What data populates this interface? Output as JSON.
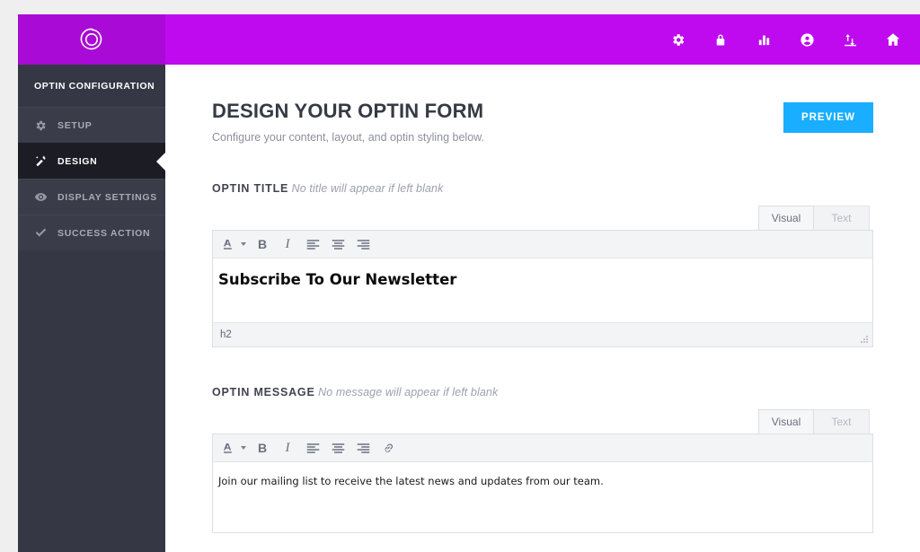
{
  "topbar": {
    "logo_icon": "rosette-logo-icon",
    "brand_color": "#bf0aef",
    "logo_block_color": "#a90ad5",
    "nav_icons": [
      {
        "name": "gear-icon"
      },
      {
        "name": "lock-icon"
      },
      {
        "name": "bar-chart-icon"
      },
      {
        "name": "user-circle-icon"
      },
      {
        "name": "import-export-icon"
      },
      {
        "name": "home-icon"
      }
    ]
  },
  "sidebar": {
    "heading": "OPTIN CONFIGURATION",
    "items": [
      {
        "label": "SETUP",
        "icon": "gear-icon",
        "active": false
      },
      {
        "label": "DESIGN",
        "icon": "magic-wand-icon",
        "active": true
      },
      {
        "label": "DISPLAY SETTINGS",
        "icon": "eye-icon",
        "active": false
      },
      {
        "label": "SUCCESS ACTION",
        "icon": "check-icon",
        "active": false
      }
    ]
  },
  "main": {
    "title": "DESIGN YOUR OPTIN FORM",
    "subtitle": "Configure your content, layout, and optin styling below.",
    "preview_button": "PREVIEW",
    "preview_button_color": "#19aeff",
    "fields": [
      {
        "label": "OPTIN TITLE",
        "hint": "No title will appear if left blank",
        "tabs": [
          {
            "label": "Visual",
            "active": true
          },
          {
            "label": "Text",
            "active": false
          }
        ],
        "toolbar": [
          {
            "name": "text-color-icon",
            "glyph": "A",
            "has_caret": true
          },
          {
            "name": "bold-icon",
            "glyph": "B"
          },
          {
            "name": "italic-icon",
            "glyph": "I"
          },
          {
            "name": "align-left-icon"
          },
          {
            "name": "align-center-icon"
          },
          {
            "name": "align-right-icon"
          }
        ],
        "content": "Subscribe To Our Newsletter",
        "status_path": "h2"
      },
      {
        "label": "OPTIN MESSAGE",
        "hint": "No message will appear if left blank",
        "tabs": [
          {
            "label": "Visual",
            "active": true
          },
          {
            "label": "Text",
            "active": false
          }
        ],
        "toolbar": [
          {
            "name": "text-color-icon",
            "glyph": "A",
            "has_caret": true
          },
          {
            "name": "bold-icon",
            "glyph": "B"
          },
          {
            "name": "italic-icon",
            "glyph": "I"
          },
          {
            "name": "align-left-icon"
          },
          {
            "name": "align-center-icon"
          },
          {
            "name": "align-right-icon"
          },
          {
            "name": "link-icon"
          }
        ],
        "content": "Join our mailing list to receive the latest news and updates from our team.",
        "status_path": ""
      }
    ]
  }
}
